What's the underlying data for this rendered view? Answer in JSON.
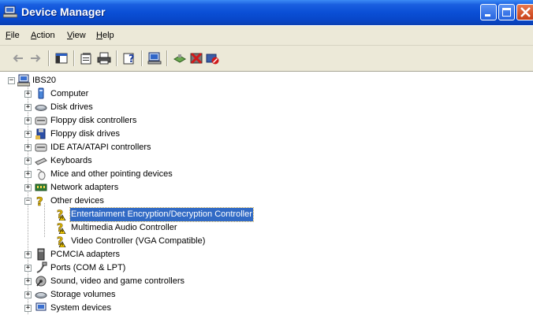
{
  "window": {
    "title": "Device Manager"
  },
  "menu": {
    "file": "File",
    "action": "Action",
    "view": "View",
    "help": "Help"
  },
  "tree": {
    "root": "IBS20",
    "items": [
      {
        "label": "Computer",
        "icon": "computer-icon",
        "expander": "+"
      },
      {
        "label": "Disk drives",
        "icon": "disk-drive-icon",
        "expander": "+"
      },
      {
        "label": "Floppy disk controllers",
        "icon": "controller-icon",
        "expander": "+"
      },
      {
        "label": "Floppy disk drives",
        "icon": "floppy-drive-icon",
        "expander": "+"
      },
      {
        "label": "IDE ATA/ATAPI controllers",
        "icon": "ide-controller-icon",
        "expander": "+"
      },
      {
        "label": "Keyboards",
        "icon": "keyboard-icon",
        "expander": "+"
      },
      {
        "label": "Mice and other pointing devices",
        "icon": "mouse-icon",
        "expander": "+"
      },
      {
        "label": "Network adapters",
        "icon": "network-adapter-icon",
        "expander": "+"
      },
      {
        "label": "Other devices",
        "icon": "unknown-device-icon",
        "expander": "-"
      },
      {
        "label": "PCMCIA adapters",
        "icon": "pcmcia-icon",
        "expander": "+"
      },
      {
        "label": "Ports (COM & LPT)",
        "icon": "port-icon",
        "expander": "+"
      },
      {
        "label": "Sound, video and game controllers",
        "icon": "sound-icon",
        "expander": "+"
      },
      {
        "label": "Storage volumes",
        "icon": "storage-volume-icon",
        "expander": "+"
      },
      {
        "label": "System devices",
        "icon": "system-device-icon",
        "expander": "+"
      }
    ],
    "other_devices": [
      {
        "label": "Entertainment Encryption/Decryption Controller",
        "selected": true
      },
      {
        "label": "Multimedia Audio Controller",
        "selected": false
      },
      {
        "label": "Video Controller (VGA Compatible)",
        "selected": false
      }
    ]
  },
  "colors": {
    "titlebar": "#0a4fd6",
    "selection": "#316ac5",
    "chrome": "#ece9d8"
  }
}
